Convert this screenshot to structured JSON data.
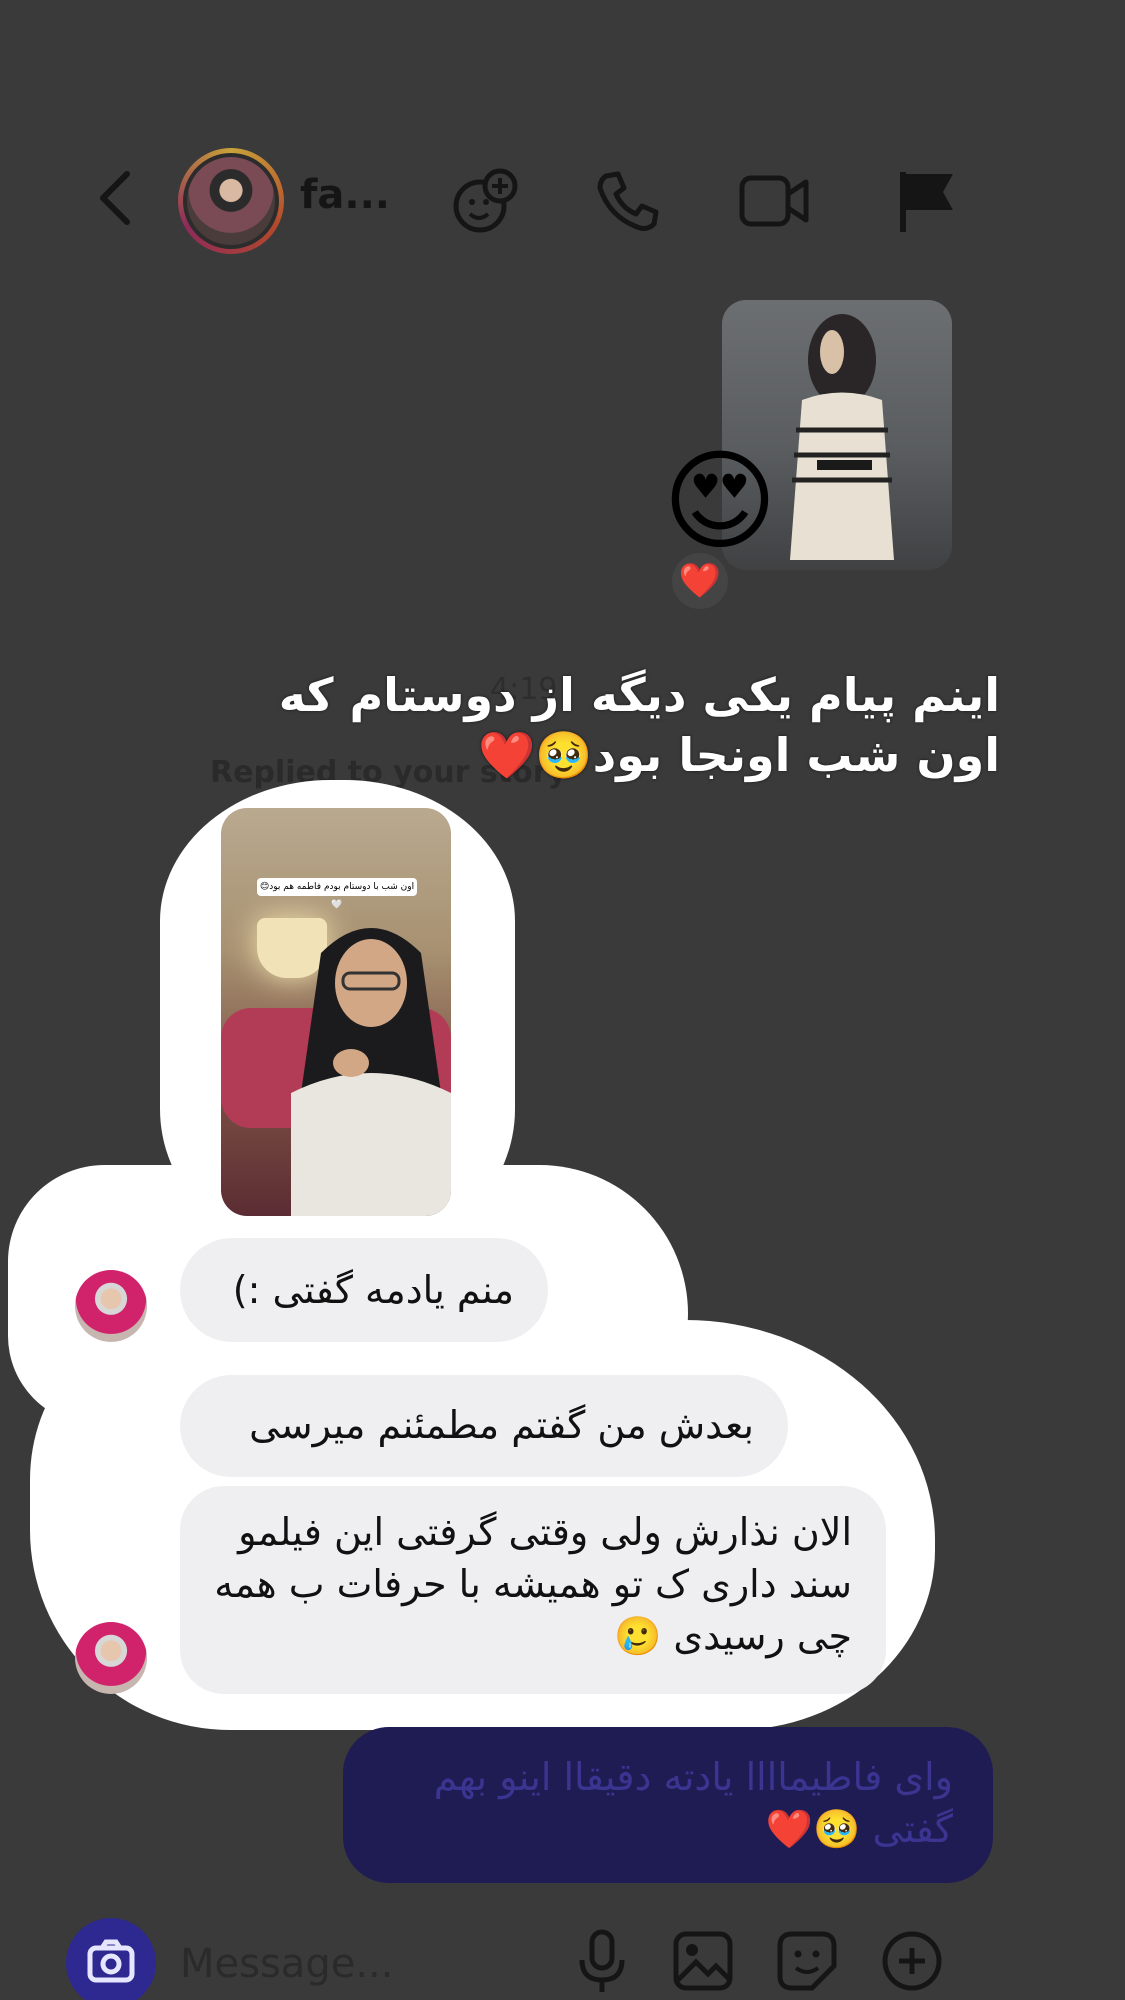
{
  "header": {
    "username": "fa...",
    "icons": [
      "chevron-left-icon",
      "avatar",
      "effects-icon",
      "phone-icon",
      "video-icon",
      "flag-icon"
    ]
  },
  "thread": {
    "emoji_reaction_big": "😍",
    "heart_reaction": "❤️",
    "ghost_time": "4:19",
    "replied_label": "Replied to your story",
    "overlay_caption_line1": "اینم پیام یکی دیگه از دوستام که",
    "overlay_caption_line2": "اون شب اونجا بود🥹❤️",
    "story_label": "اون شب با دوستام بودم فاطمه هم بود😊🤍",
    "messages": [
      {
        "text": "منم یادمه گفتی :)",
        "from": "other"
      },
      {
        "text": "بعدش من گفتم مطمئنم میرسی",
        "from": "other"
      },
      {
        "text": "الان نذارش ولی وقتی گرفتی این فیلمو سند داری ک تو همیشه با حرفات ب همه چی رسیدی 🥲",
        "from": "other"
      }
    ],
    "own_message": "وای فاطیماااا یادته دقیقاا اینو بهم گفتی 🥹❤️"
  },
  "composer": {
    "placeholder": "Message...",
    "icons": [
      "camera-icon",
      "microphone-icon",
      "gallery-icon",
      "sticker-icon",
      "plus-icon"
    ]
  },
  "colors": {
    "background": "#3a3a3a",
    "own_bubble": "#1f1c54",
    "other_bubble": "#efeff1",
    "camera_button": "#2e2990"
  }
}
